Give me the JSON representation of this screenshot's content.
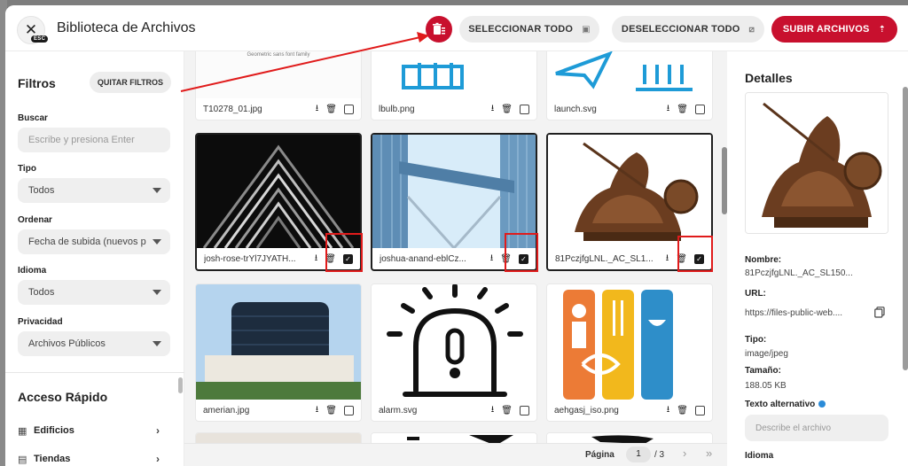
{
  "header": {
    "title": "Biblioteca de Archivos",
    "esc_badge": "ESC",
    "select_all": "SELECCIONAR TODO",
    "deselect_all": "DESELECCIONAR TODO",
    "upload": "SUBIR ARCHIVOS"
  },
  "sidebar": {
    "filters_title": "Filtros",
    "clear_filters": "QUITAR FILTROS",
    "search_label": "Buscar",
    "search_placeholder": "Escribe y presiona Enter",
    "type_label": "Tipo",
    "type_value": "Todos",
    "order_label": "Ordenar",
    "order_value": "Fecha de subida (nuevos p",
    "language_label": "Idioma",
    "language_value": "Todos",
    "privacy_label": "Privacidad",
    "privacy_value": "Archivos Públicos",
    "quick_title": "Acceso Rápido",
    "quick_items": [
      {
        "label": "Edificios"
      },
      {
        "label": "Tiendas"
      }
    ]
  },
  "grid": {
    "files": [
      {
        "name": "T10278_01.jpg",
        "selected": false
      },
      {
        "name": "lbulb.png",
        "selected": false
      },
      {
        "name": "launch.svg",
        "selected": false
      },
      {
        "name": "josh-rose-trYl7JYATH...",
        "selected": true
      },
      {
        "name": "joshua-anand-eblCz...",
        "selected": true
      },
      {
        "name": "81PczjfgLNL._AC_SL1...",
        "selected": true
      },
      {
        "name": "amerian.jpg",
        "selected": false
      },
      {
        "name": "alarm.svg",
        "selected": false
      },
      {
        "name": "aehgasj_iso.png",
        "selected": false
      }
    ],
    "thumb_caption": "Geometric sans font family"
  },
  "pagination": {
    "label": "Página",
    "current": "1",
    "total": "/ 3"
  },
  "details": {
    "title": "Detalles",
    "name_label": "Nombre:",
    "name_value": "81PczjfgLNL._AC_SL150...",
    "url_label": "URL:",
    "url_value": "https://files-public-web....",
    "type_label": "Tipo:",
    "type_value": "image/jpeg",
    "size_label": "Tamaño:",
    "size_value": "188.05 KB",
    "alt_label": "Texto alternativo",
    "alt_placeholder": "Describe el archivo",
    "language_label": "Idioma"
  },
  "colors": {
    "accent": "#c8102e",
    "annotation": "#e01b1b",
    "icon_blue": "#1e9bd7"
  }
}
